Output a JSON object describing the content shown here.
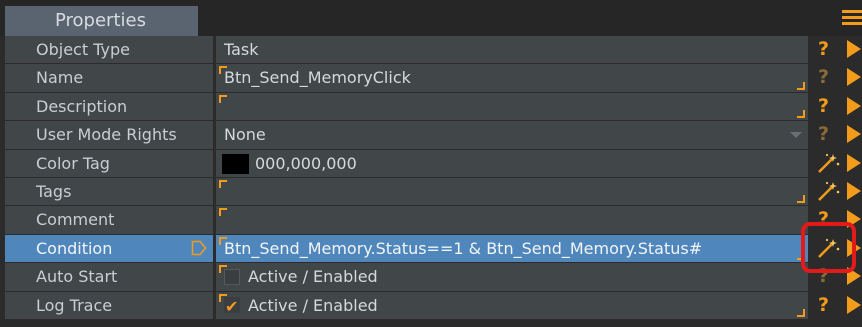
{
  "panel": {
    "title": "Properties"
  },
  "rows": [
    {
      "label": "Object Type",
      "value": "Task",
      "action": "help"
    },
    {
      "label": "Name",
      "value": "Btn_Send_MemoryClick",
      "action": "help"
    },
    {
      "label": "Description",
      "value": "",
      "action": "help"
    },
    {
      "label": "User Mode Rights",
      "value": "None",
      "action": "help"
    },
    {
      "label": "Color Tag",
      "value": "000,000,000",
      "action": "wand"
    },
    {
      "label": "Tags",
      "value": "",
      "action": "wand"
    },
    {
      "label": "Comment",
      "value": "",
      "action": "help"
    },
    {
      "label": "Condition",
      "value": "Btn_Send_Memory.Status==1 & Btn_Send_Memory.Status#",
      "action": "wand",
      "selected": true
    },
    {
      "label": "Auto Start",
      "value": "Active / Enabled",
      "checked": false,
      "action": "help"
    },
    {
      "label": "Log Trace",
      "value": "Active / Enabled",
      "checked": true,
      "action": "help"
    }
  ],
  "colors": {
    "accent": "#f39c1c",
    "selected_row": "#4f87bd",
    "row_bg": "#414649",
    "highlight": "#e21a1a",
    "color_tag_swatch": "#000000"
  },
  "icons": [
    "menu-icon",
    "help-icon",
    "magic-wand-icon",
    "expand-arrow-icon",
    "dropdown-arrow-icon",
    "checkmark-icon"
  ]
}
